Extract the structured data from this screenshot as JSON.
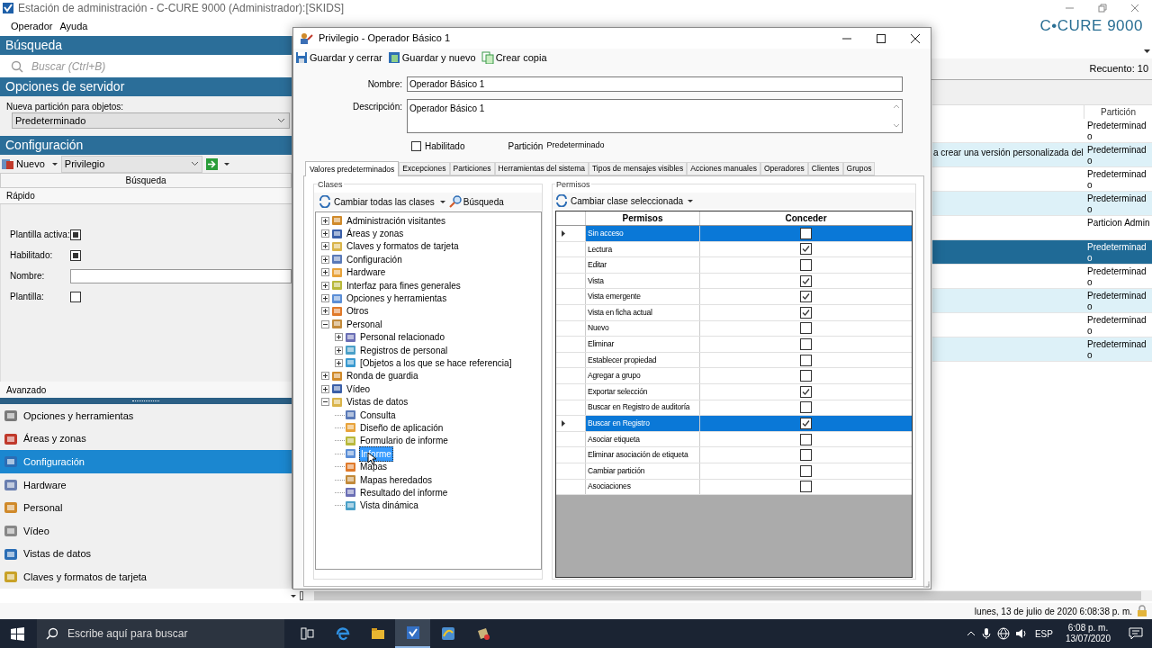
{
  "window": {
    "title": "Estación de administración - C-CURE 9000 (Administrador):[SKIDS]",
    "logo": "C•CURE 9000"
  },
  "menu": [
    "Operador",
    "Ayuda"
  ],
  "sidebar": {
    "search_header": "Búsqueda",
    "search_placeholder": "Buscar (Ctrl+B)",
    "server_header": "Opciones de servidor",
    "partition_label": "Nueva partición para objetos:",
    "partition_value": "Predeterminado",
    "config_header": "Configuración",
    "new_button": "Nuevo",
    "type_value": "Privilegio",
    "search_tab": "Búsqueda",
    "quick": "Rápido",
    "fields": [
      {
        "label": "Plantilla activa:",
        "kind": "check",
        "checked": true
      },
      {
        "label": "Habilitado:",
        "kind": "check",
        "checked": true
      },
      {
        "label": "Nombre:",
        "kind": "text"
      },
      {
        "label": "Plantilla:",
        "kind": "check",
        "checked": false
      }
    ],
    "advanced": "Avanzado",
    "nav": [
      {
        "label": "Opciones y herramientas",
        "selected": false
      },
      {
        "label": "Áreas y zonas",
        "selected": false
      },
      {
        "label": "Configuración",
        "selected": true
      },
      {
        "label": "Hardware",
        "selected": false
      },
      {
        "label": "Personal",
        "selected": false
      },
      {
        "label": "Vídeo",
        "selected": false
      },
      {
        "label": "Vistas de datos",
        "selected": false
      },
      {
        "label": "Claves y formatos de tarjeta",
        "selected": false
      }
    ]
  },
  "results": {
    "count": "Recuento: 10",
    "columns": [
      "Partición"
    ],
    "rows": [
      {
        "description": "",
        "partition": "Predeterminado",
        "selected": false
      },
      {
        "description": "a crear una versión personalizada del",
        "partition": "Predeterminado",
        "selected": false
      },
      {
        "description": "",
        "partition": "Predeterminado",
        "selected": false
      },
      {
        "description": "",
        "partition": "Predeterminado",
        "selected": false
      },
      {
        "description": "",
        "partition": "Particion Admin",
        "selected": false
      },
      {
        "description": "",
        "partition": "Predeterminado",
        "selected": true
      },
      {
        "description": "",
        "partition": "Predeterminado",
        "selected": false
      },
      {
        "description": "",
        "partition": "Predeterminado",
        "selected": false
      },
      {
        "description": "",
        "partition": "Predeterminado",
        "selected": false
      },
      {
        "description": "",
        "partition": "Predeterminado",
        "selected": false
      }
    ]
  },
  "dialog": {
    "title": "Privilegio - Operador Básico 1",
    "toolbar": [
      "Guardar y cerrar",
      "Guardar y nuevo",
      "Crear copia"
    ],
    "name_label": "Nombre:",
    "name_value": "Operador Básico 1",
    "description_label": "Descripción:",
    "description_value": "Operador Básico 1",
    "enabled": {
      "label": "Habilitado",
      "checked": false
    },
    "partition_label": "Partición",
    "partition_value": "Predeterminado",
    "tabs": [
      {
        "label": "Valores predeterminados",
        "selected": true
      },
      {
        "label": "Excepciones",
        "selected": false
      },
      {
        "label": "Particiones",
        "selected": false
      },
      {
        "label": "Herramientas del sistema",
        "selected": false
      },
      {
        "label": "Tipos de mensajes visibles",
        "selected": false
      },
      {
        "label": "Acciones manuales",
        "selected": false
      },
      {
        "label": "Operadores",
        "selected": false
      },
      {
        "label": "Clientes",
        "selected": false
      },
      {
        "label": "Grupos",
        "selected": false
      }
    ],
    "classes": {
      "title": "Clases",
      "change_all": "Cambiar todas las clases",
      "search": "Búsqueda",
      "tree": [
        {
          "label": "Administración visitantes",
          "kind": "group",
          "expanded": false,
          "selected": false
        },
        {
          "label": "Áreas y zonas",
          "kind": "group",
          "expanded": false,
          "selected": false
        },
        {
          "label": "Claves y formatos de tarjeta",
          "kind": "group",
          "expanded": false,
          "selected": false
        },
        {
          "label": "Configuración",
          "kind": "group",
          "expanded": false,
          "selected": false
        },
        {
          "label": "Hardware",
          "kind": "group",
          "expanded": false,
          "selected": false
        },
        {
          "label": "Interfaz para fines generales",
          "kind": "group",
          "expanded": false,
          "selected": false
        },
        {
          "label": "Opciones y herramientas",
          "kind": "group",
          "expanded": false,
          "selected": false
        },
        {
          "label": "Otros",
          "kind": "group",
          "expanded": false,
          "selected": false
        },
        {
          "label": "Personal",
          "kind": "group",
          "expanded": true,
          "selected": false,
          "children": [
            {
              "label": "Personal relacionado",
              "kind": "group",
              "expanded": false,
              "selected": false
            },
            {
              "label": "Registros de personal",
              "kind": "group",
              "expanded": false,
              "selected": false
            },
            {
              "label": "[Objetos a los que se hace referencia]",
              "kind": "group",
              "expanded": false,
              "selected": false
            }
          ]
        },
        {
          "label": "Ronda de guardia",
          "kind": "group",
          "expanded": false,
          "selected": false
        },
        {
          "label": "Vídeo",
          "kind": "group",
          "expanded": false,
          "selected": false
        },
        {
          "label": "Vistas de datos",
          "kind": "group",
          "expanded": true,
          "selected": false,
          "children": [
            {
              "label": "Consulta",
              "kind": "item",
              "selected": false
            },
            {
              "label": "Diseño de aplicación",
              "kind": "item",
              "selected": false
            },
            {
              "label": "Formulario de informe",
              "kind": "item",
              "selected": false
            },
            {
              "label": "Informe",
              "kind": "item",
              "selected": true
            },
            {
              "label": "Mapas",
              "kind": "item",
              "selected": false
            },
            {
              "label": "Mapas heredados",
              "kind": "item",
              "selected": false
            },
            {
              "label": "Resultado del informe",
              "kind": "item",
              "selected": false
            },
            {
              "label": "Vista dinámica",
              "kind": "item",
              "selected": false
            }
          ]
        }
      ]
    },
    "permissions": {
      "title": "Permisos",
      "change_selected": "Cambiar clase seleccionada",
      "columns": [
        "Permisos",
        "Conceder"
      ],
      "rows": [
        {
          "label": "Sin acceso",
          "granted": false,
          "selected": true
        },
        {
          "label": "Lectura",
          "granted": true,
          "selected": false
        },
        {
          "label": "Editar",
          "granted": false,
          "selected": false
        },
        {
          "label": "Vista",
          "granted": true,
          "selected": false
        },
        {
          "label": "Vista emergente",
          "granted": true,
          "selected": false
        },
        {
          "label": "Vista en ficha actual",
          "granted": true,
          "selected": false
        },
        {
          "label": "Nuevo",
          "granted": false,
          "selected": false
        },
        {
          "label": "Eliminar",
          "granted": false,
          "selected": false
        },
        {
          "label": "Establecer propiedad",
          "granted": false,
          "selected": false
        },
        {
          "label": "Agregar a grupo",
          "granted": false,
          "selected": false
        },
        {
          "label": "Exportar selección",
          "granted": true,
          "selected": false
        },
        {
          "label": "Buscar en Registro de auditoría",
          "granted": false,
          "selected": false
        },
        {
          "label": "Buscar en Registro",
          "granted": true,
          "selected": true
        },
        {
          "label": "Asociar etiqueta",
          "granted": false,
          "selected": false
        },
        {
          "label": "Eliminar asociación de etiqueta",
          "granted": false,
          "selected": false
        },
        {
          "label": "Cambiar partición",
          "granted": false,
          "selected": false
        },
        {
          "label": "Asociaciones",
          "granted": false,
          "selected": false
        }
      ]
    }
  },
  "status_bar": "lunes, 13 de julio de 2020 6:08:38 p. m.",
  "taskbar": {
    "search_placeholder": "Escribe aquí para buscar",
    "language": "ESP",
    "time": "6:08 p. m.",
    "date": "13/07/2020"
  }
}
